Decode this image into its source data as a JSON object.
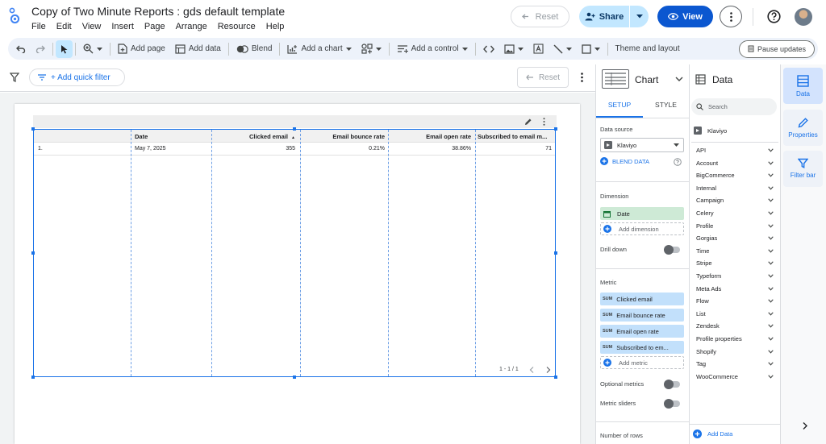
{
  "header": {
    "title": "Copy of Two Minute Reports : gds default template",
    "menu": [
      "File",
      "Edit",
      "View",
      "Insert",
      "Page",
      "Arrange",
      "Resource",
      "Help"
    ],
    "reset_label": "Reset",
    "share_label": "Share",
    "view_label": "View"
  },
  "toolbar": {
    "add_page": "Add page",
    "add_data": "Add data",
    "blend": "Blend",
    "add_chart": "Add a chart",
    "add_control": "Add a control",
    "theme": "Theme and layout",
    "pause": "Pause updates"
  },
  "filterbar": {
    "quick_filter": "+ Add quick filter",
    "reset_label": "Reset"
  },
  "table": {
    "columns": [
      "Date",
      "Clicked email",
      "Email bounce rate",
      "Email open rate",
      "Subscribed to email m..."
    ],
    "sort_indicator": "▲",
    "rows": [
      {
        "index": "1.",
        "date": "May 7, 2025",
        "clicked": "355",
        "bounce": "0.21%",
        "open": "38.86%",
        "subscribed": "71"
      }
    ],
    "pagination": "1 - 1 / 1"
  },
  "chart_panel": {
    "title": "Chart",
    "tab_setup": "SETUP",
    "tab_style": "STYLE",
    "data_source_label": "Data source",
    "data_source": "Klaviyo",
    "blend_data": "BLEND DATA",
    "dimension_label": "Dimension",
    "dimension": "Date",
    "add_dimension": "Add dimension",
    "drill_down": "Drill down",
    "metric_label": "Metric",
    "sum_tag": "SUM",
    "metrics": [
      "Clicked email",
      "Email bounce rate",
      "Email open rate",
      "Subscribed to em..."
    ],
    "add_metric": "Add metric",
    "optional_metrics": "Optional metrics",
    "metric_sliders": "Metric sliders",
    "number_of_rows": "Number of rows"
  },
  "data_panel": {
    "title": "Data",
    "search_placeholder": "Search",
    "source": "Klaviyo",
    "groups": [
      "API",
      "Account",
      "BigCommerce",
      "Internal",
      "Campaign",
      "Celery",
      "Profile",
      "Gorgias",
      "Time",
      "Stripe",
      "Typeform",
      "Meta Ads",
      "Flow",
      "List",
      "Zendesk",
      "Profile properties",
      "Shopify",
      "Tag",
      "WooCommerce"
    ],
    "add_data": "Add Data"
  },
  "rail": {
    "data": "Data",
    "properties": "Properties",
    "filter_bar": "Filter bar"
  },
  "colors": {
    "accent": "#1a73e8",
    "share_bg": "#c2e7ff",
    "view_bg": "#0b57d0",
    "dimension_chip": "#ceead6",
    "metric_chip": "#c2e0fb",
    "toolbar_bg": "#edf2fa"
  }
}
